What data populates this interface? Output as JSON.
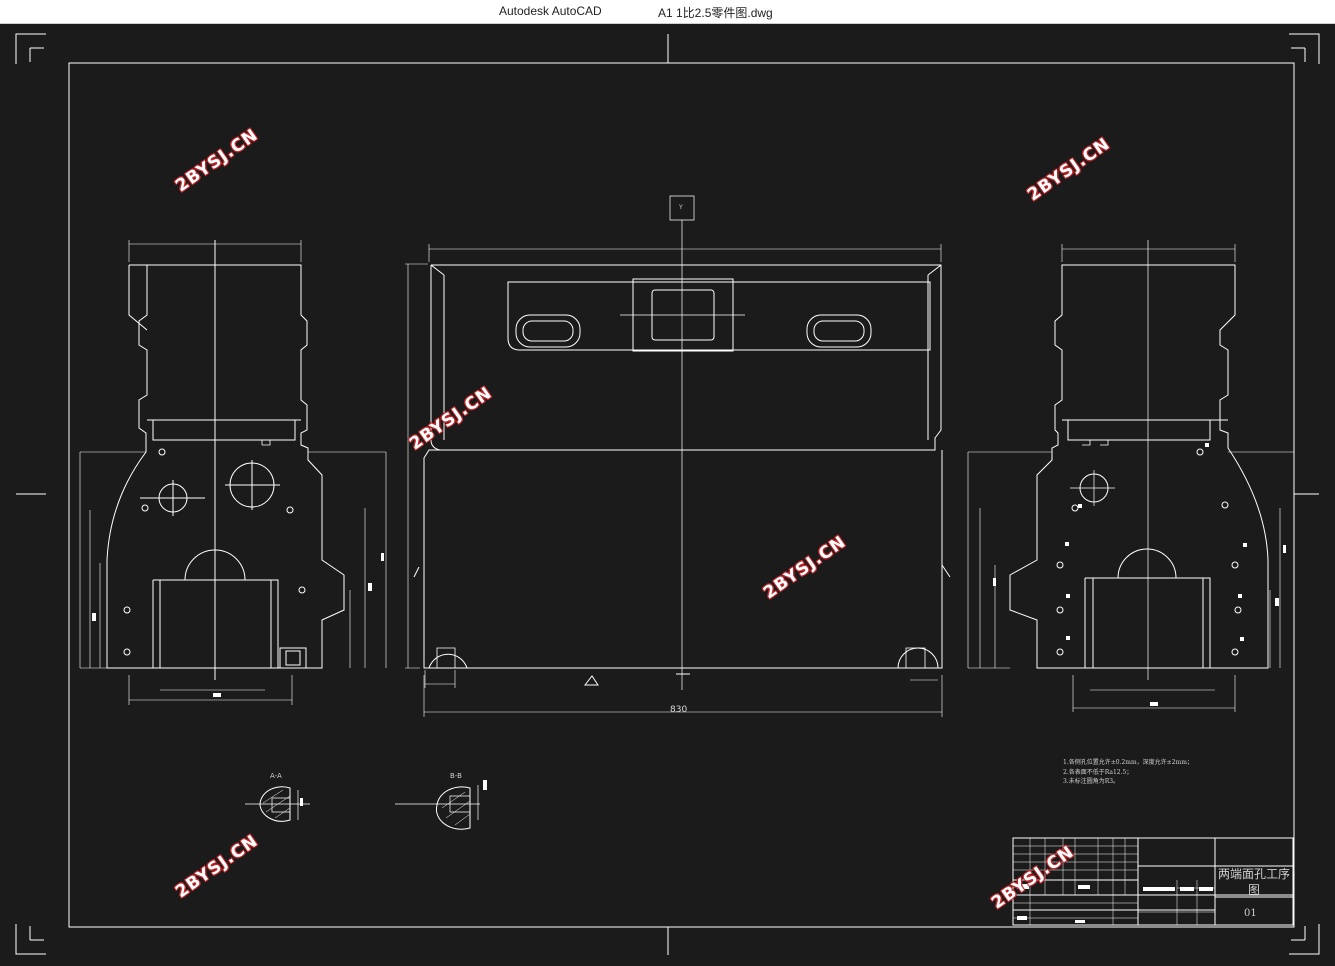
{
  "window": {
    "app_name": "Autodesk AutoCAD",
    "document_name": "A1 1比2.5零件图.dwg"
  },
  "drawing": {
    "dimension_main": "830",
    "section_aa": "A-A",
    "section_bb": "B-B",
    "view_marker": "Y",
    "notes": [
      "1.各侧孔位置允许±0.2mm，深度允许±2mm；",
      "2.各表面不低于Ra12.5；",
      "3.未标注圆角为R3。"
    ],
    "title_block": {
      "title": "两端面孔工序图",
      "number": "01"
    }
  },
  "watermark": {
    "text": "2BYSJ.CN"
  },
  "colors": {
    "canvas": "#1b1b1b",
    "line": "#ffffff",
    "watermark_outline": "#c0282c"
  }
}
